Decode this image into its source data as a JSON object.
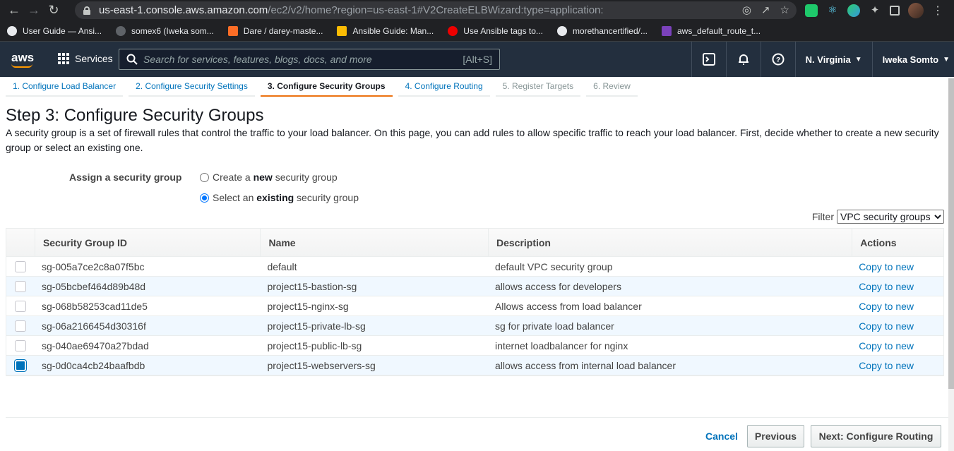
{
  "browser": {
    "url_host": "us-east-1.console.aws.amazon.com",
    "url_rest": "/ec2/v2/home?region=us-east-1#V2CreateELBWizard:type=application:",
    "bookmarks": [
      {
        "label": "User Guide — Ansi...",
        "color": "#e8eaed"
      },
      {
        "label": "somex6 (Iweka som...",
        "color": "#5f6368"
      },
      {
        "label": "Dare / darey-maste...",
        "color": "#fc6d26"
      },
      {
        "label": "Ansible Guide: Man...",
        "color": "#fbbc04"
      },
      {
        "label": "Use Ansible tags to...",
        "color": "#ee0000"
      },
      {
        "label": "morethancertified/...",
        "color": "#e8eaed"
      },
      {
        "label": "aws_default_route_t...",
        "color": "#7b42bc"
      }
    ]
  },
  "aws_nav": {
    "logo": "aws",
    "services": "Services",
    "search_placeholder": "Search for services, features, blogs, docs, and more",
    "search_shortcut": "[Alt+S]",
    "region": "N. Virginia",
    "user": "Iweka Somto"
  },
  "wizard": {
    "tabs": [
      {
        "label": "1. Configure Load Balancer",
        "state": "link"
      },
      {
        "label": "2. Configure Security Settings",
        "state": "link"
      },
      {
        "label": "3. Configure Security Groups",
        "state": "active"
      },
      {
        "label": "4. Configure Routing",
        "state": "link"
      },
      {
        "label": "5. Register Targets",
        "state": "disabled"
      },
      {
        "label": "6. Review",
        "state": "disabled"
      }
    ],
    "title": "Step 3: Configure Security Groups",
    "description": "A security group is a set of firewall rules that control the traffic to your load balancer. On this page, you can add rules to allow specific traffic to reach your load balancer. First, decide whether to create a new security group or select an existing one."
  },
  "assign": {
    "label": "Assign a security group",
    "option_new_pre": "Create a ",
    "option_new_bold": "new",
    "option_new_post": " security group",
    "option_existing_pre": "Select an ",
    "option_existing_bold": "existing",
    "option_existing_post": " security group",
    "selected": "existing"
  },
  "filter": {
    "label": "Filter",
    "value": "VPC security groups"
  },
  "table": {
    "headers": [
      "Security Group ID",
      "Name",
      "Description",
      "Actions"
    ],
    "rows": [
      {
        "id": "sg-005a7ce2c8a07f5bc",
        "name": "default",
        "description": "default VPC security group",
        "action": "Copy to new",
        "checked": false
      },
      {
        "id": "sg-05bcbef464d89b48d",
        "name": "project15-bastion-sg",
        "description": "allows access for developers",
        "action": "Copy to new",
        "checked": false
      },
      {
        "id": "sg-068b58253cad11de5",
        "name": "project15-nginx-sg",
        "description": "Allows access from load balancer",
        "action": "Copy to new",
        "checked": false
      },
      {
        "id": "sg-06a2166454d30316f",
        "name": "project15-private-lb-sg",
        "description": "sg for private load balancer",
        "action": "Copy to new",
        "checked": false
      },
      {
        "id": "sg-040ae69470a27bdad",
        "name": "project15-public-lb-sg",
        "description": "internet loadbalancer for nginx",
        "action": "Copy to new",
        "checked": false
      },
      {
        "id": "sg-0d0ca4cb24baafbdb",
        "name": "project15-webservers-sg",
        "description": "allows access from internal load balancer",
        "action": "Copy to new",
        "checked": true
      }
    ]
  },
  "footer": {
    "cancel": "Cancel",
    "previous": "Previous",
    "next": "Next: Configure Routing"
  }
}
